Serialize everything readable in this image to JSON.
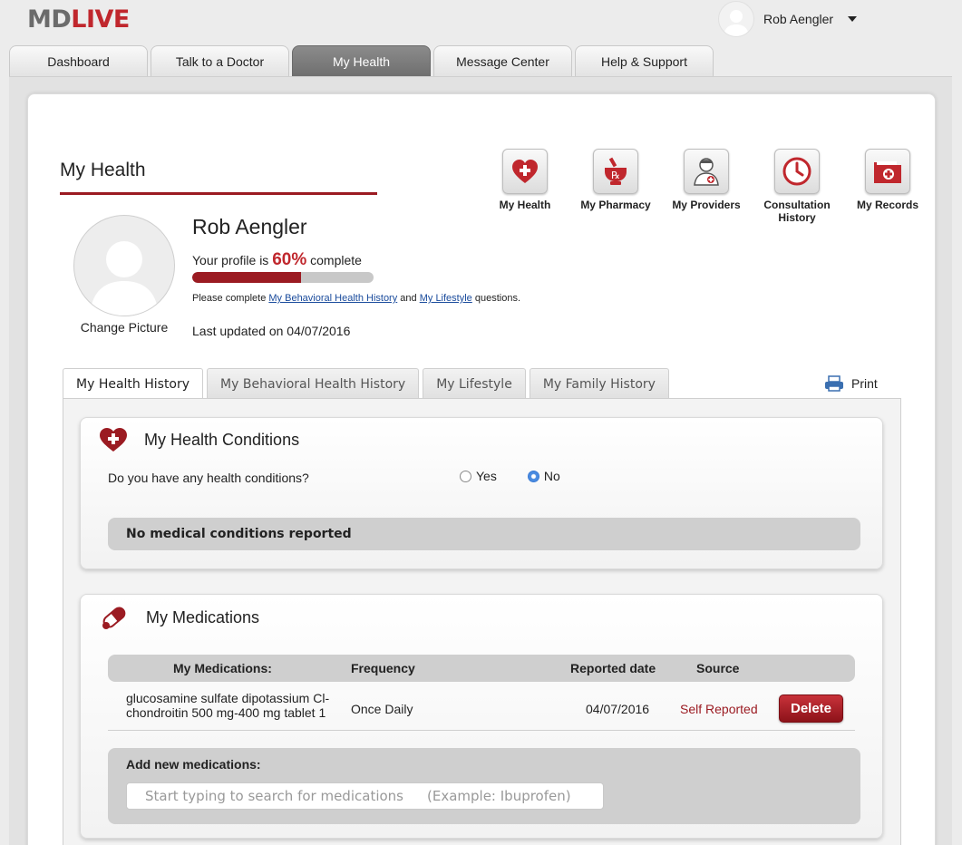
{
  "brand": {
    "md": "MD",
    "live": "LIVE"
  },
  "user": {
    "name": "Rob Aengler"
  },
  "nav": {
    "tabs": [
      {
        "label": "Dashboard"
      },
      {
        "label": "Talk to a Doctor"
      },
      {
        "label": "My Health",
        "active": true
      },
      {
        "label": "Message Center"
      },
      {
        "label": "Help & Support"
      }
    ]
  },
  "page": {
    "title": "My Health"
  },
  "quicknav": [
    {
      "label": "My Health",
      "icon": "heart-plus-icon"
    },
    {
      "label": "My Pharmacy",
      "icon": "mortar-rx-icon"
    },
    {
      "label": "My Providers",
      "icon": "doctor-icon"
    },
    {
      "label": "Consultation History",
      "icon": "clock-icon"
    },
    {
      "label": "My Records",
      "icon": "folder-plus-icon"
    }
  ],
  "profile": {
    "name": "Rob Aengler",
    "change_picture": "Change Picture",
    "complete_prefix": "Your profile is",
    "complete_pct": "60%",
    "complete_suffix": "complete",
    "progress_fraction": 0.6,
    "please_prefix": "Please complete",
    "link_behavioral": "My Behavioral Health History",
    "and": "and",
    "link_lifestyle": "My Lifestyle",
    "please_suffix": "questions.",
    "last_updated": "Last updated on 04/07/2016"
  },
  "subtabs": [
    {
      "label": "My Health History",
      "active": true
    },
    {
      "label": "My Behavioral Health History"
    },
    {
      "label": "My Lifestyle"
    },
    {
      "label": "My Family History"
    }
  ],
  "print_label": "Print",
  "conditions": {
    "title": "My Health Conditions",
    "question": "Do you have any health conditions?",
    "yes": "Yes",
    "no": "No",
    "selected": "No",
    "empty_message": "No medical conditions reported"
  },
  "medications": {
    "title": "My Medications",
    "columns": [
      "My Medications:",
      "Frequency",
      "Reported date",
      "Source"
    ],
    "rows": [
      {
        "name": "glucosamine sulfate dipotassium Cl-chondroitin 500 mg-400 mg tablet 1",
        "frequency": "Once Daily",
        "reported_date": "04/07/2016",
        "source": "Self Reported",
        "action": "Delete"
      }
    ],
    "add_label": "Add new medications:",
    "search_placeholder": "Start typing to search for medications",
    "search_example": "(Example: Ibuprofen)"
  },
  "colors": {
    "brand_red": "#c0272d",
    "dark_red": "#9b1b22",
    "link_blue": "#1a4b9c"
  }
}
